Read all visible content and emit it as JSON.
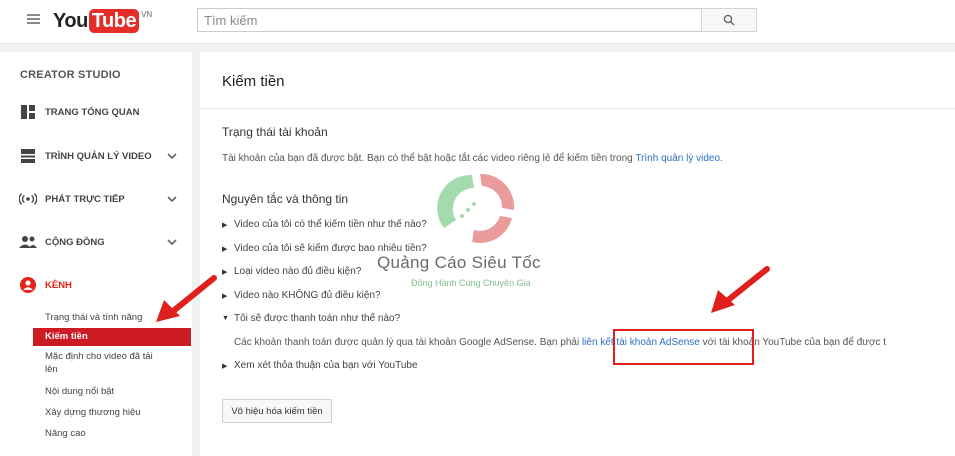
{
  "header": {
    "menu_icon": "hamburger-icon",
    "logo_you": "You",
    "logo_tube": "Tube",
    "logo_country": "VN",
    "search_placeholder": "Tìm kiếm",
    "search_icon": "search-icon"
  },
  "sidebar": {
    "title": "CREATOR STUDIO",
    "items": [
      {
        "label": "TRANG TỔNG QUAN",
        "icon": "dashboard-icon"
      },
      {
        "label": "TRÌNH QUẢN LÝ VIDEO",
        "icon": "video-manager-icon"
      },
      {
        "label": "PHÁT TRỰC TIẾP",
        "icon": "live-broadcast-icon"
      },
      {
        "label": "CỘNG ĐỒNG",
        "icon": "community-icon"
      },
      {
        "label": "KÊNH",
        "icon": "channel-user-icon"
      }
    ],
    "sub_items": [
      "Trạng thái và tính năng",
      "Kiếm tiền",
      "Mặc định cho video đã tải lên",
      "Nội dung nổi bật",
      "Xây dựng thương hiệu",
      "Nâng cao"
    ],
    "accent_color": "#e62117"
  },
  "main": {
    "title": "Kiếm tiền",
    "account_status_heading": "Trạng thái tài khoản",
    "account_status_text": "Tài khoản của bạn đã được bật. Bạn có thể bật hoặc tắt các video riêng lẻ để kiếm tiền trong ",
    "account_status_link": "Trình quản lý video",
    "account_status_end": ".",
    "guidelines_heading": "Nguyên tắc và thông tin",
    "questions": [
      "Video của tôi có thể kiếm tiền như thế nào?",
      "Video của tôi sẽ kiếm được bao nhiêu tiền?",
      "Loại video nào đủ điều kiện?",
      "Video nào KHÔNG đủ điều kiện?",
      "Tôi sẽ được thanh toán như thế nào?"
    ],
    "answer_text": "Các khoản thanh toán được quản lý qua tài khoản Google AdSense. Bạn phải ",
    "answer_link": "liên kết tài khoản AdSense",
    "answer_end": " với tài khoản YouTube của bạn để được t",
    "review_item": "Xem xét thỏa thuận của bạn với YouTube",
    "disable_button": "Vô hiệu hóa kiếm tiền",
    "link_color": "#2a6fc4"
  },
  "watermark": {
    "title": "Quảng Cáo Siêu Tốc",
    "subtitle": "Đồng Hành Cùng Chuyên Gia"
  },
  "annotations": {
    "arrow_color": "#e0201d"
  }
}
